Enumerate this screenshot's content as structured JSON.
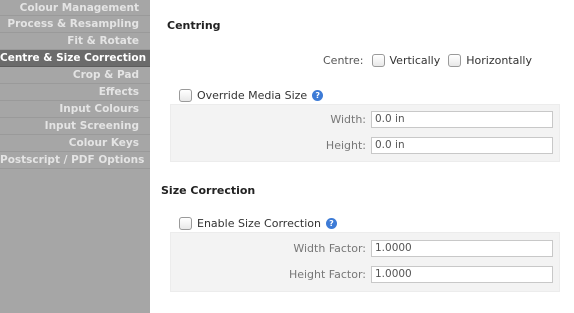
{
  "sidebar": {
    "items": [
      {
        "label": "Colour Management",
        "active": false
      },
      {
        "label": "Process & Resampling",
        "active": false
      },
      {
        "label": "Fit & Rotate",
        "active": false
      },
      {
        "label": "Centre & Size Correction",
        "active": true
      },
      {
        "label": "Crop & Pad",
        "active": false
      },
      {
        "label": "Effects",
        "active": false
      },
      {
        "label": "Input Colours",
        "active": false
      },
      {
        "label": "Input Screening",
        "active": false
      },
      {
        "label": "Colour Keys",
        "active": false
      },
      {
        "label": "Postscript / PDF Options",
        "active": false
      }
    ]
  },
  "centring": {
    "title": "Centring",
    "centre_label": "Centre:",
    "vertically_label": "Vertically",
    "horizontally_label": "Horizontally",
    "override_label": "Override Media Size",
    "width_label": "Width:",
    "width_value": "0.0 in",
    "height_label": "Height:",
    "height_value": "0.0 in"
  },
  "size_correction": {
    "title": "Size Correction",
    "enable_label": "Enable Size Correction",
    "width_factor_label": "Width Factor:",
    "width_factor_value": "1.0000",
    "height_factor_label": "Height Factor:",
    "height_factor_value": "1.0000"
  },
  "icons": {
    "help": "help-icon",
    "help_glyph": "?"
  },
  "colors": {
    "sidebar_bg": "#a6a6a6",
    "sidebar_active": "#6b6b6b",
    "help_blue": "#3d7bd6"
  }
}
